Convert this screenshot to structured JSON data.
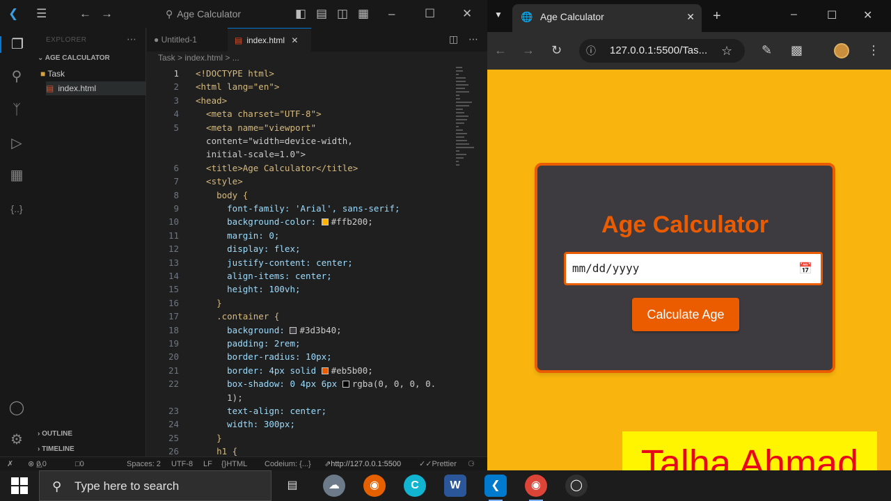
{
  "vscode": {
    "search_label": "Age Calculator",
    "explorer_title": "EXPLORER",
    "folder_name": "AGE CALCULATOR",
    "tree": [
      {
        "label": "Task",
        "type": "folder"
      },
      {
        "label": "index.html",
        "type": "file"
      }
    ],
    "outline_label": "OUTLINE",
    "timeline_label": "TIMELINE",
    "tabs": [
      {
        "label": "Untitled-1"
      },
      {
        "label": "index.html"
      }
    ],
    "breadcrumb": "Task  >  index.html  >  ...",
    "code_lines": [
      {
        "n": "1",
        "text": "<!DOCTYPE html>"
      },
      {
        "n": "2",
        "text": "<html lang=\"en\">"
      },
      {
        "n": "3",
        "text": "<head>"
      },
      {
        "n": "4",
        "text": "  <meta charset=\"UTF-8\">"
      },
      {
        "n": "5",
        "text": "  <meta name=\"viewport\""
      },
      {
        "n": "",
        "text": "  content=\"width=device-width,"
      },
      {
        "n": "",
        "text": "  initial-scale=1.0\">"
      },
      {
        "n": "6",
        "text": "  <title>Age Calculator</title>"
      },
      {
        "n": "7",
        "text": "  <style>"
      },
      {
        "n": "8",
        "text": "    body {"
      },
      {
        "n": "9",
        "text": "      font-family: 'Arial', sans-serif;"
      },
      {
        "n": "10",
        "text": "      background-color: #ffb200;",
        "swatch": "#ffb200"
      },
      {
        "n": "11",
        "text": "      margin: 0;"
      },
      {
        "n": "12",
        "text": "      display: flex;"
      },
      {
        "n": "13",
        "text": "      justify-content: center;"
      },
      {
        "n": "14",
        "text": "      align-items: center;"
      },
      {
        "n": "15",
        "text": "      height: 100vh;"
      },
      {
        "n": "16",
        "text": "    }"
      },
      {
        "n": "17",
        "text": "    .container {"
      },
      {
        "n": "18",
        "text": "      background: #3d3b40;",
        "swatch": "#3d3b40"
      },
      {
        "n": "19",
        "text": "      padding: 2rem;"
      },
      {
        "n": "20",
        "text": "      border-radius: 10px;"
      },
      {
        "n": "21",
        "text": "      border: 4px solid #eb5b00;",
        "swatch": "#eb5b00"
      },
      {
        "n": "22",
        "text": "      box-shadow: 0 4px 6px rgba(0, 0, 0, 0.",
        "swatch": "#000000"
      },
      {
        "n": "",
        "text": "      1);"
      },
      {
        "n": "23",
        "text": "      text-align: center;"
      },
      {
        "n": "24",
        "text": "      width: 300px;"
      },
      {
        "n": "25",
        "text": "    }"
      },
      {
        "n": "26",
        "text": "    h1 {"
      }
    ],
    "status": {
      "errors": "0",
      "warnings": "0",
      "ports": "0",
      "spaces": "Spaces: 2",
      "encoding": "UTF-8",
      "eol": "LF",
      "language": "HTML",
      "codeium": "Codeium: {...}",
      "live_server": "http://127.0.0.1:5500",
      "prettier": "Prettier"
    }
  },
  "chrome": {
    "tab_title": "Age Calculator",
    "url": "127.0.0.1:5500/Tas...",
    "page": {
      "heading": "Age Calculator",
      "date_placeholder": "mm/dd/yyyy",
      "button_label": "Calculate Age"
    }
  },
  "watermark": "Talha Ahmad",
  "taskbar": {
    "search_placeholder": "Type here to search"
  },
  "colors": {
    "page_bg": "#f9b50e",
    "container_bg": "#3d3b40",
    "accent": "#eb5b00",
    "vscode_bg": "#1f1f1f",
    "watermark_bg": "#fff500",
    "watermark_text": "#e8071a"
  }
}
